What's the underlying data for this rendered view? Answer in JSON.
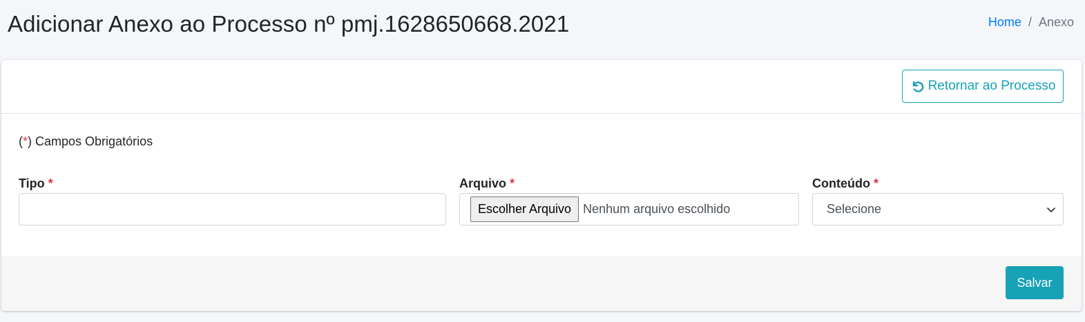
{
  "header": {
    "title": "Adicionar Anexo ao Processo nº pmj.1628650668.2021",
    "breadcrumb": {
      "home": "Home",
      "separator": "/",
      "current": "Anexo"
    }
  },
  "card": {
    "return_button": {
      "label": "Retornar ao Processo",
      "icon": "undo-icon"
    },
    "required_note": {
      "open": "(",
      "star": "*",
      "close": ")",
      "text": " Campos Obrigatórios"
    },
    "fields": {
      "tipo": {
        "label": "Tipo",
        "star": "*",
        "value": ""
      },
      "arquivo": {
        "label": "Arquivo",
        "star": "*",
        "button": "Escolher Arquivo",
        "status": "Nenhum arquivo escolhido"
      },
      "conteudo": {
        "label": "Conteúdo",
        "star": "*",
        "selected": "Selecione",
        "icon": "chevron-down-icon"
      }
    },
    "save_button": {
      "label": "Salvar"
    }
  },
  "colors": {
    "accent": "#17a2b8",
    "link": "#007bff",
    "required": "#dc3545",
    "background": "#f4f6f9"
  }
}
